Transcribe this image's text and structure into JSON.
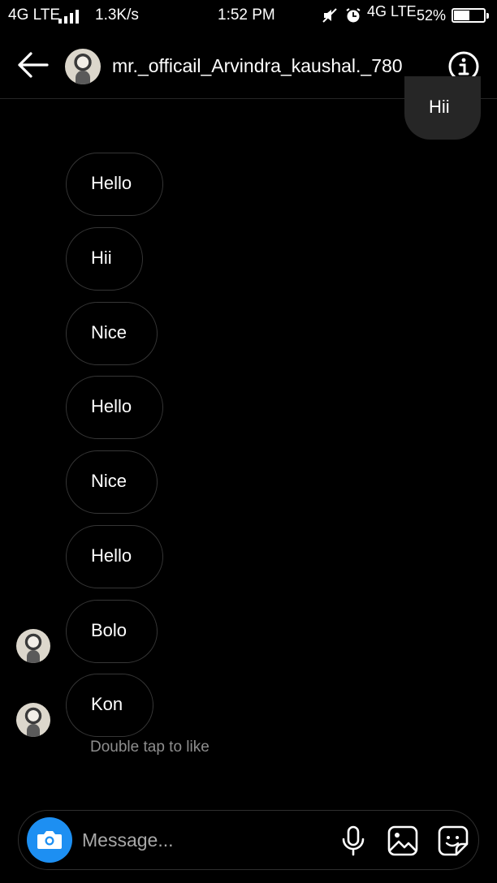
{
  "status_bar": {
    "network_left": "4G LTE",
    "speed": "1.3K/s",
    "time": "1:52 PM",
    "network_right": "4G LTE",
    "battery_percent": "52%",
    "battery_level": 0.52
  },
  "header": {
    "username": "mr._officail_Arvindra_kaushal._780",
    "back_icon": "arrow-left-icon",
    "info_icon": "info-icon"
  },
  "messages": [
    {
      "text": "Hii",
      "direction": "outgoing"
    },
    {
      "text": "Hello",
      "direction": "incoming"
    },
    {
      "text": "Hii",
      "direction": "incoming"
    },
    {
      "text": "Nice",
      "direction": "incoming"
    },
    {
      "text": "Hello",
      "direction": "incoming"
    },
    {
      "text": "Nice",
      "direction": "incoming"
    },
    {
      "text": "Hello",
      "direction": "incoming"
    },
    {
      "text": "Bolo",
      "direction": "incoming"
    },
    {
      "text": "Kon",
      "direction": "incoming"
    }
  ],
  "hint": "Double tap to like",
  "composer": {
    "placeholder": "Message...",
    "camera_icon": "camera-icon",
    "mic_icon": "microphone-icon",
    "gallery_icon": "gallery-icon",
    "sticker_icon": "sticker-icon"
  },
  "colors": {
    "background": "#000000",
    "outgoing_bubble": "#262626",
    "incoming_border": "#363636",
    "accent": "#1d8ff2"
  }
}
